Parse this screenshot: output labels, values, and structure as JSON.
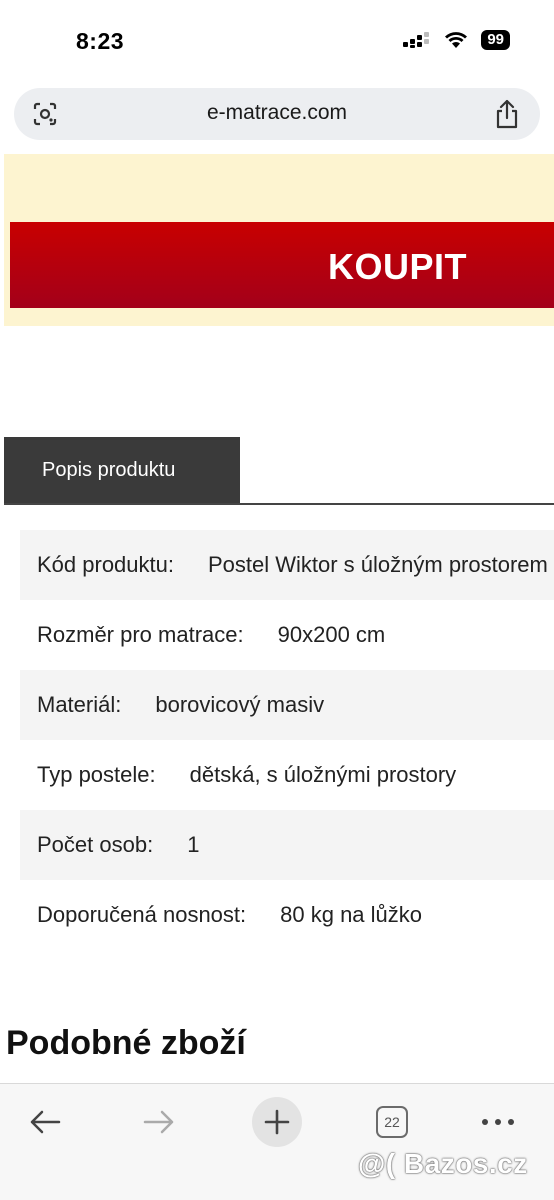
{
  "status_bar": {
    "time": "8:23",
    "battery": "99",
    "icons": [
      "cellular-signal-icon",
      "wifi-icon",
      "battery-icon"
    ]
  },
  "browser": {
    "url": "e-matrace.com",
    "left_icon": "visual-search-icon",
    "right_icon": "share-icon"
  },
  "buy": {
    "label": "KOUPIT",
    "color": "#b5000f",
    "area_color": "#fdf4d0"
  },
  "tabs": [
    {
      "label": "Popis produktu",
      "active": true
    }
  ],
  "specs": [
    {
      "label": "Kód produktu:",
      "value": "Postel Wiktor s úložným prostorem"
    },
    {
      "label": "Rozměr pro matrace:",
      "value": "90x200 cm"
    },
    {
      "label": "Materiál:",
      "value": "borovicový masiv"
    },
    {
      "label": "Typ postele:",
      "value": "dětská, s úložnými prostory"
    },
    {
      "label": "Počet osob:",
      "value": "1"
    },
    {
      "label": "Doporučená nosnost:",
      "value": "80 kg na lůžko"
    }
  ],
  "similar": {
    "title": "Podobné zboží"
  },
  "toolbar": {
    "tab_count": "22",
    "icons": [
      "back-arrow-icon",
      "forward-arrow-icon",
      "plus-icon",
      "tabs-icon",
      "more-icon"
    ]
  },
  "watermark": "@( Bazos.cz"
}
